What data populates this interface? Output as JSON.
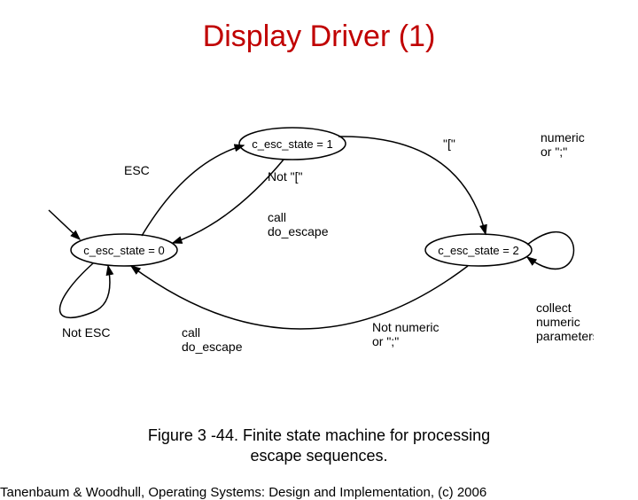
{
  "title": "Display Driver (1)",
  "caption_line1": "Figure 3 -44. Finite state machine for processing",
  "caption_line2": "escape sequences.",
  "footer": "Tanenbaum & Woodhull, Operating Systems: Design and Implementation, (c) 2006",
  "diagram": {
    "states": {
      "s0": "c_esc_state = 0",
      "s1": "c_esc_state = 1",
      "s2": "c_esc_state = 2"
    },
    "edges": {
      "esc": "ESC",
      "not_esc": "Not ESC",
      "bracket": "\"[\"",
      "not_bracket": "Not \"[\"",
      "call_do_escape1": "call",
      "call_do_escape2": "do_escape",
      "not_numeric1": "Not numeric",
      "not_numeric2": "or \";\"",
      "numeric1": "numeric",
      "numeric2": "or \";\"",
      "collect1": "collect",
      "collect2": "numeric",
      "collect3": "parameters"
    }
  }
}
